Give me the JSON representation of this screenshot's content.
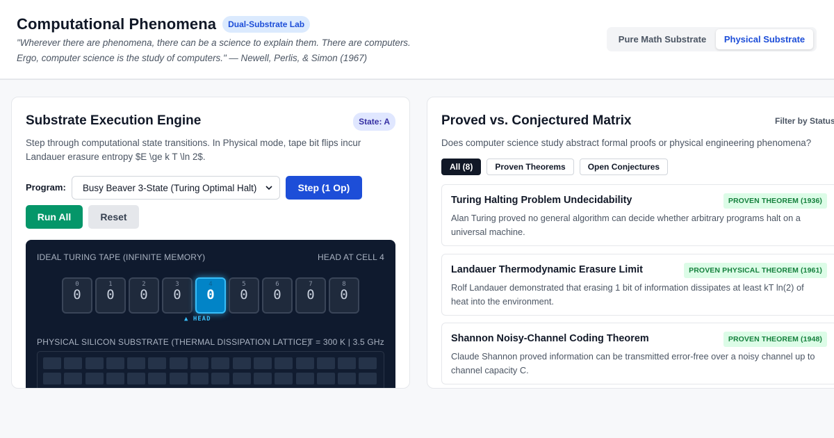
{
  "header": {
    "title": "Computational Phenomena",
    "badge": "Dual-Substrate Lab",
    "quote": "\"Wherever there are phenomena, there can be a science to explain them. There are computers. Ergo, computer science is the study of computers.\" — Newell, Perlis, & Simon (1967)",
    "substrate_options": [
      "Pure Math Substrate",
      "Physical Substrate"
    ],
    "active_substrate": "Physical Substrate"
  },
  "engine": {
    "title": "Substrate Execution Engine",
    "state_badge": "State: A",
    "description": "Step through computational state transitions. In Physical mode, tape bit flips incur Landauer erasure entropy $E \\ge k T \\ln 2$.",
    "program_label": "Program:",
    "program_selected": "Busy Beaver 3-State (Turing Optimal Halt)",
    "step_label": "Step (1 Op)",
    "run_all_label": "Run All",
    "reset_label": "Reset",
    "tape_label": "IDEAL TURING TAPE (INFINITE MEMORY)",
    "head_position_label": "HEAD AT CELL 4",
    "tape": [
      {
        "index": "0",
        "bit": "0"
      },
      {
        "index": "1",
        "bit": "0"
      },
      {
        "index": "2",
        "bit": "0"
      },
      {
        "index": "3",
        "bit": "0"
      },
      {
        "index": "4",
        "bit": "0"
      },
      {
        "index": "5",
        "bit": "0"
      },
      {
        "index": "6",
        "bit": "0"
      },
      {
        "index": "7",
        "bit": "0"
      },
      {
        "index": "8",
        "bit": "0"
      }
    ],
    "head_marker": "▲ HEAD",
    "lattice_label": "PHYSICAL SILICON SUBSTRATE (THERMAL DISSIPATION LATTICE)",
    "lattice_params": "T = 300 K | 3.5 GHz"
  },
  "matrix": {
    "title": "Proved vs. Conjectured Matrix",
    "filter_label": "Filter by Status",
    "subtitle": "Does computer science study abstract formal proofs or physical engineering phenomena?",
    "chips": [
      "All (8)",
      "Proven Theorems",
      "Open Conjectures"
    ],
    "active_chip": "All (8)",
    "items": [
      {
        "title": "Turing Halting Problem Undecidability",
        "badge": "PROVEN THEOREM (1936)",
        "description": "Alan Turing proved no general algorithm can decide whether arbitrary programs halt on a universal machine."
      },
      {
        "title": "Landauer Thermodynamic Erasure Limit",
        "badge": "PROVEN PHYSICAL THEOREM (1961)",
        "description": "Rolf Landauer demonstrated that erasing 1 bit of information dissipates at least kT ln(2) of heat into the environment."
      },
      {
        "title": "Shannon Noisy-Channel Coding Theorem",
        "badge": "PROVEN THEOREM (1948)",
        "description": "Claude Shannon proved information can be transmitted error-free over a noisy channel up to channel capacity C."
      }
    ]
  },
  "colors": {
    "primary": "#1d4ed8",
    "success": "#059669",
    "dark_panel": "#0f1a2e",
    "head_active": "#0284c7"
  }
}
